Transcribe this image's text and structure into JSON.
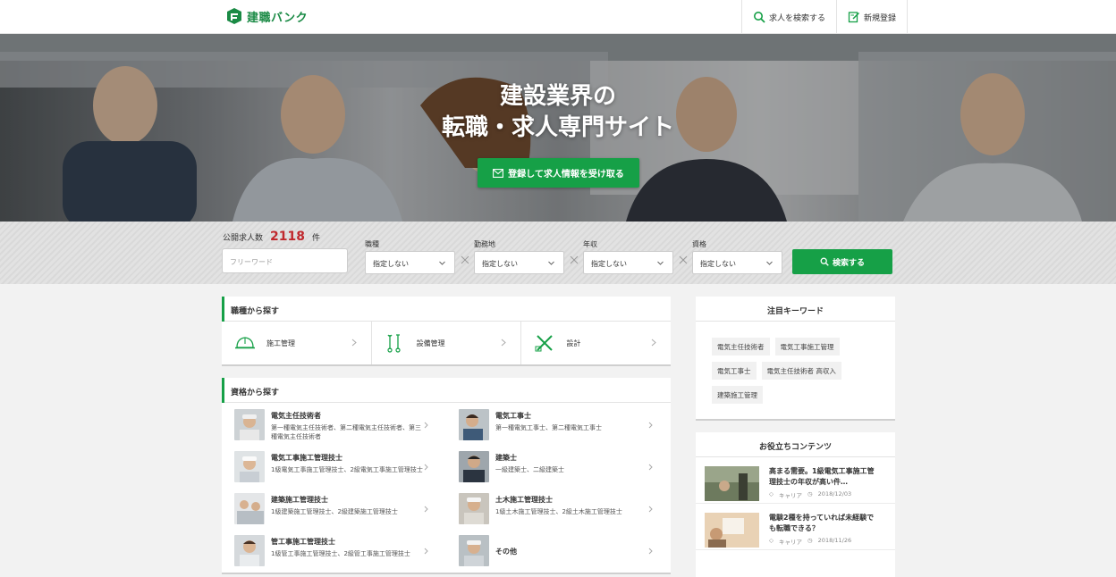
{
  "header": {
    "logo_text": "建職バンク",
    "nav": [
      {
        "label": "求人を検索する",
        "icon": "search-icon"
      },
      {
        "label": "新規登録",
        "icon": "edit-icon"
      }
    ]
  },
  "hero": {
    "title_line1": "建設業界の",
    "title_line2": "転職・求人専門サイト",
    "cta_label": "登録して求人情報を受け取る",
    "cta_icon": "mail-icon"
  },
  "search": {
    "job_count_label": "公開求人数",
    "job_count": "2118",
    "job_count_unit": "件",
    "free_word_placeholder": "フリーワード",
    "filters": [
      {
        "label": "職種",
        "value": "指定しない"
      },
      {
        "label": "勤務地",
        "value": "指定しない"
      },
      {
        "label": "年収",
        "value": "指定しない"
      },
      {
        "label": "資格",
        "value": "指定しない"
      }
    ],
    "search_button": "検索する"
  },
  "occupation": {
    "heading": "職種から探す",
    "items": [
      {
        "label": "施工管理",
        "icon": "hard-hat-icon"
      },
      {
        "label": "設備管理",
        "icon": "wrench-icon"
      },
      {
        "label": "設計",
        "icon": "drafting-tools-icon"
      }
    ]
  },
  "qualification": {
    "heading": "資格から探す",
    "items": [
      {
        "title": "電気主任技術者",
        "desc": "第一種電気主任技術者、第二種電気主任技術者、第三種電気主任技術者"
      },
      {
        "title": "電気工事士",
        "desc": "第一種電気工事士、第二種電気工事士"
      },
      {
        "title": "電気工事施工管理技士",
        "desc": "1級電気工事施工管理技士、2級電気工事施工管理技士"
      },
      {
        "title": "建築士",
        "desc": "一級建築士、二級建築士"
      },
      {
        "title": "建築施工管理技士",
        "desc": "1級建築施工管理技士、2級建築施工管理技士"
      },
      {
        "title": "土木施工管理技士",
        "desc": "1級土木施工管理技士、2級土木施工管理技士"
      },
      {
        "title": "管工事施工管理技士",
        "desc": "1級管工事施工管理技士、2級管工事施工管理技士"
      },
      {
        "title": "その他",
        "desc": ""
      }
    ]
  },
  "keywords": {
    "heading": "注目キーワード",
    "items": [
      "電気主任技術者",
      "電気工事施工管理",
      "電気工事士",
      "電気主任技術者 高収入",
      "建築施工管理"
    ]
  },
  "contents": {
    "heading": "お役立ちコンテンツ",
    "articles": [
      {
        "title": "高まる需要。1級電気工事施工管理技士の年収が高い件…",
        "category": "キャリア",
        "date": "2018/12/03"
      },
      {
        "title": "電験2種を持っていれば未経験でも転職できる？",
        "category": "キャリア",
        "date": "2018/11/26"
      }
    ]
  },
  "colors": {
    "brand_green": "#16a047",
    "count_red": "#c0282d"
  }
}
